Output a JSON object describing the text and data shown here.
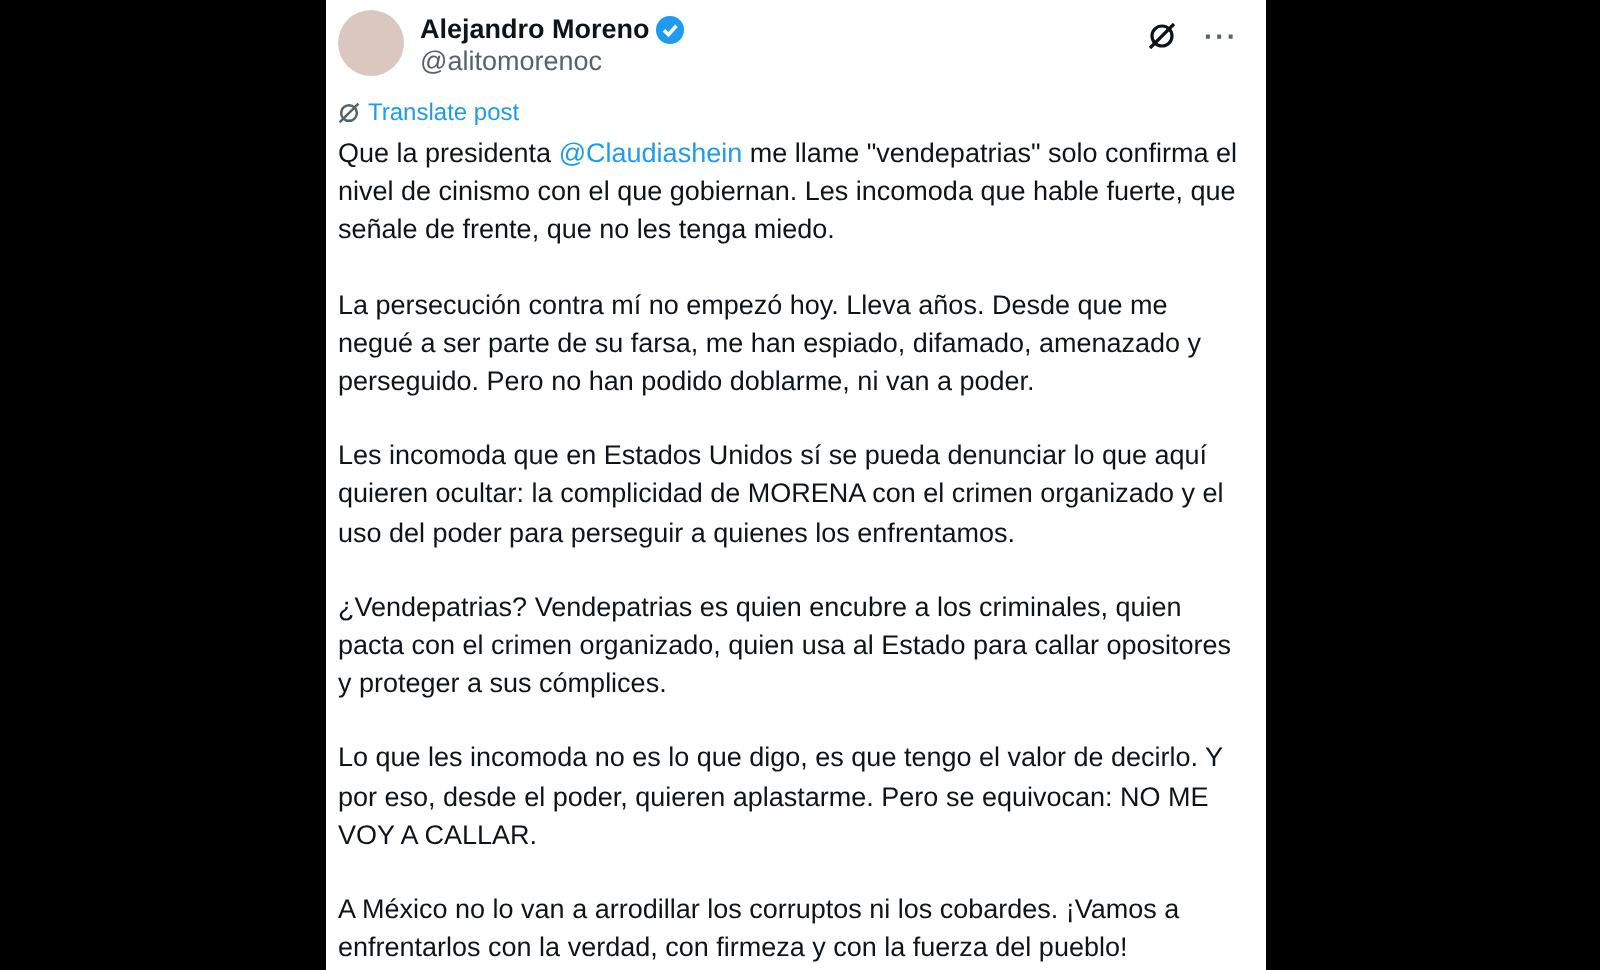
{
  "author": {
    "name": "Alejandro Moreno",
    "verified": true,
    "handle": "@alitomorenoc"
  },
  "translate": "Translate post",
  "menu": "···",
  "paragraphs": [
    {
      "segments": [
        {
          "kind": "text",
          "text": "Que la presidenta "
        },
        {
          "kind": "mention",
          "text": "@Claudiashein"
        },
        {
          "kind": "text",
          "text": " me llame \"vendepatrias\" solo confirma el nivel de cinismo con el que gobiernan. Les incomoda que hable fuerte, que señale de frente, que no les tenga miedo."
        }
      ]
    },
    {
      "segments": [
        {
          "kind": "text",
          "text": "La persecución contra mí no empezó hoy. Lleva años. Desde que me negué a ser parte de su farsa, me han espiado, difamado, amenazado y perseguido. Pero no han podido doblarme, ni van a poder."
        }
      ]
    },
    {
      "segments": [
        {
          "kind": "text",
          "text": "Les incomoda que en Estados Unidos sí se pueda denunciar lo que aquí quieren ocultar: la complicidad de MORENA con el crimen organizado y el uso del poder para perseguir a quienes los enfrentamos."
        }
      ]
    },
    {
      "segments": [
        {
          "kind": "text",
          "text": "¿Vendepatrias? Vendepatrias es quien encubre a los criminales, quien pacta con el crimen organizado, quien usa al Estado para callar opositores y proteger a sus cómplices."
        }
      ]
    },
    {
      "segments": [
        {
          "kind": "text",
          "text": "Lo que les incomoda no es lo que digo, es que tengo el valor de decirlo. Y por eso, desde el poder, quieren aplastarme. Pero se equivocan: NO ME VOY A CALLAR."
        }
      ]
    },
    {
      "segments": [
        {
          "kind": "text",
          "text": "A México no lo van a arrodillar los corruptos ni los cobardes. ¡Vamos a enfrentarlos con la verdad, con firmeza y con la fuerza del pueblo!"
        }
      ]
    }
  ]
}
